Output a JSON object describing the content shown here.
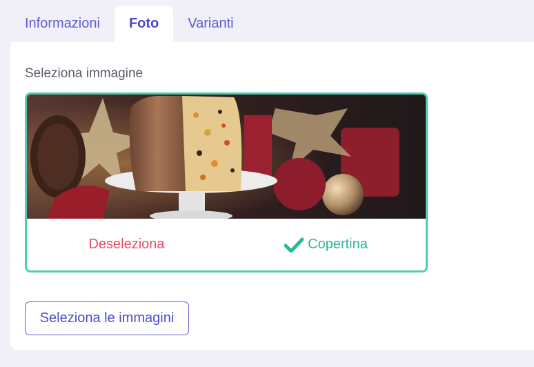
{
  "tabs": [
    {
      "label": "Informazioni",
      "active": false
    },
    {
      "label": "Foto",
      "active": true
    },
    {
      "label": "Varianti",
      "active": false
    }
  ],
  "section": {
    "label": "Seleziona immagine"
  },
  "image_card": {
    "deselect_label": "Deseleziona",
    "cover_label": "Copertina",
    "cover_icon": "check-icon"
  },
  "actions": {
    "select_images_label": "Seleziona le immagini"
  },
  "colors": {
    "accent": "#5e5ad6",
    "selected_border": "#4fcdb3",
    "deselect": "#ee4a62",
    "cover": "#2cb598"
  }
}
